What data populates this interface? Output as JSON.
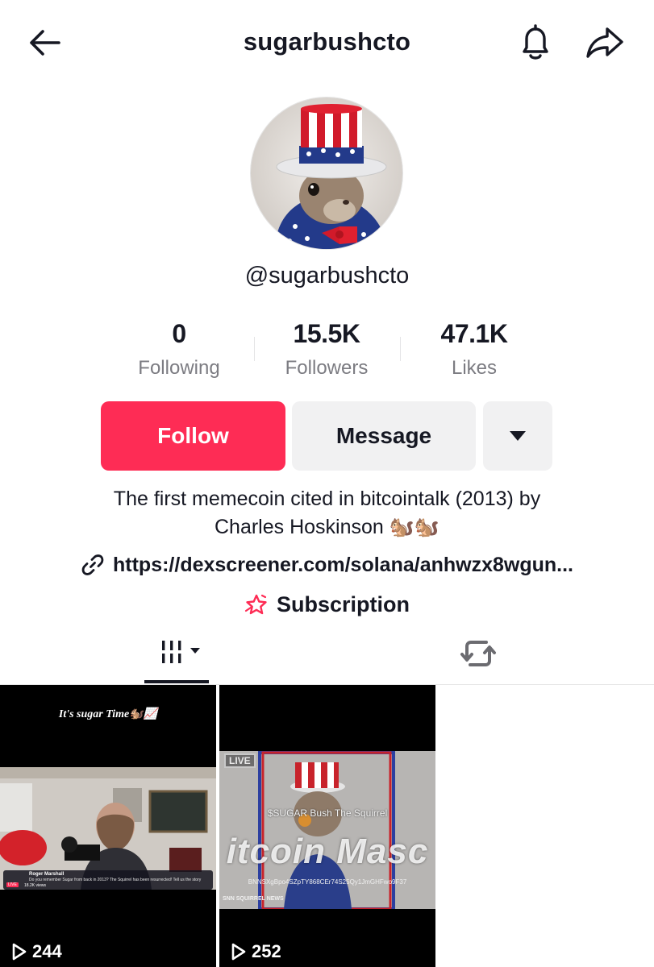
{
  "header": {
    "title": "sugarbushcto",
    "back_icon": "arrow-left-icon",
    "bell_icon": "bell-icon",
    "share_icon": "share-icon"
  },
  "profile": {
    "handle": "@sugarbushcto",
    "avatar": "squirrel-in-uncle-sam-hat"
  },
  "stats": [
    {
      "value": "0",
      "label": "Following"
    },
    {
      "value": "15.5K",
      "label": "Followers"
    },
    {
      "value": "47.1K",
      "label": "Likes"
    }
  ],
  "actions": {
    "follow_label": "Follow",
    "message_label": "Message",
    "more_icon": "caret-down-icon"
  },
  "bio": {
    "line1": "The first memecoin cited in bitcointalk (2013) by",
    "line2": "Charles Hoskinson 🐿️🐿️",
    "link": "https://dexscreener.com/solana/anhwzx8wgun...",
    "link_icon": "link-icon",
    "subscription_label": "Subscription",
    "subscription_icon": "star-badge-icon"
  },
  "tabs": [
    {
      "name": "videos",
      "icon": "grid-icon",
      "active": true
    },
    {
      "name": "reposts",
      "icon": "repost-icon",
      "active": false
    }
  ],
  "videos": [
    {
      "views": "244",
      "caption": "It's sugar Time🐿️📈",
      "live_name": "Roger Marshall",
      "live_text": "Do you remember Sugar from back in 2013? The Squirrel has been resurrected! Tell us the story",
      "live_views": "18.2K views",
      "live_badge": "LIVE"
    },
    {
      "views": "252",
      "live_badge": "LIVE",
      "overlay_title": "$SUGAR Bush The Squirrel",
      "overlay_big": "itcoin Masc",
      "overlay_addr": "BNNSXgBpo4SZpTY868CEr74S25Qy1JmGHFwo9F37",
      "overlay_news": "SNN SQUIRREL NEWS"
    }
  ],
  "colors": {
    "accent": "#fe2c55",
    "secondary_button": "#f1f1f2",
    "muted_text": "#7c7c82"
  }
}
